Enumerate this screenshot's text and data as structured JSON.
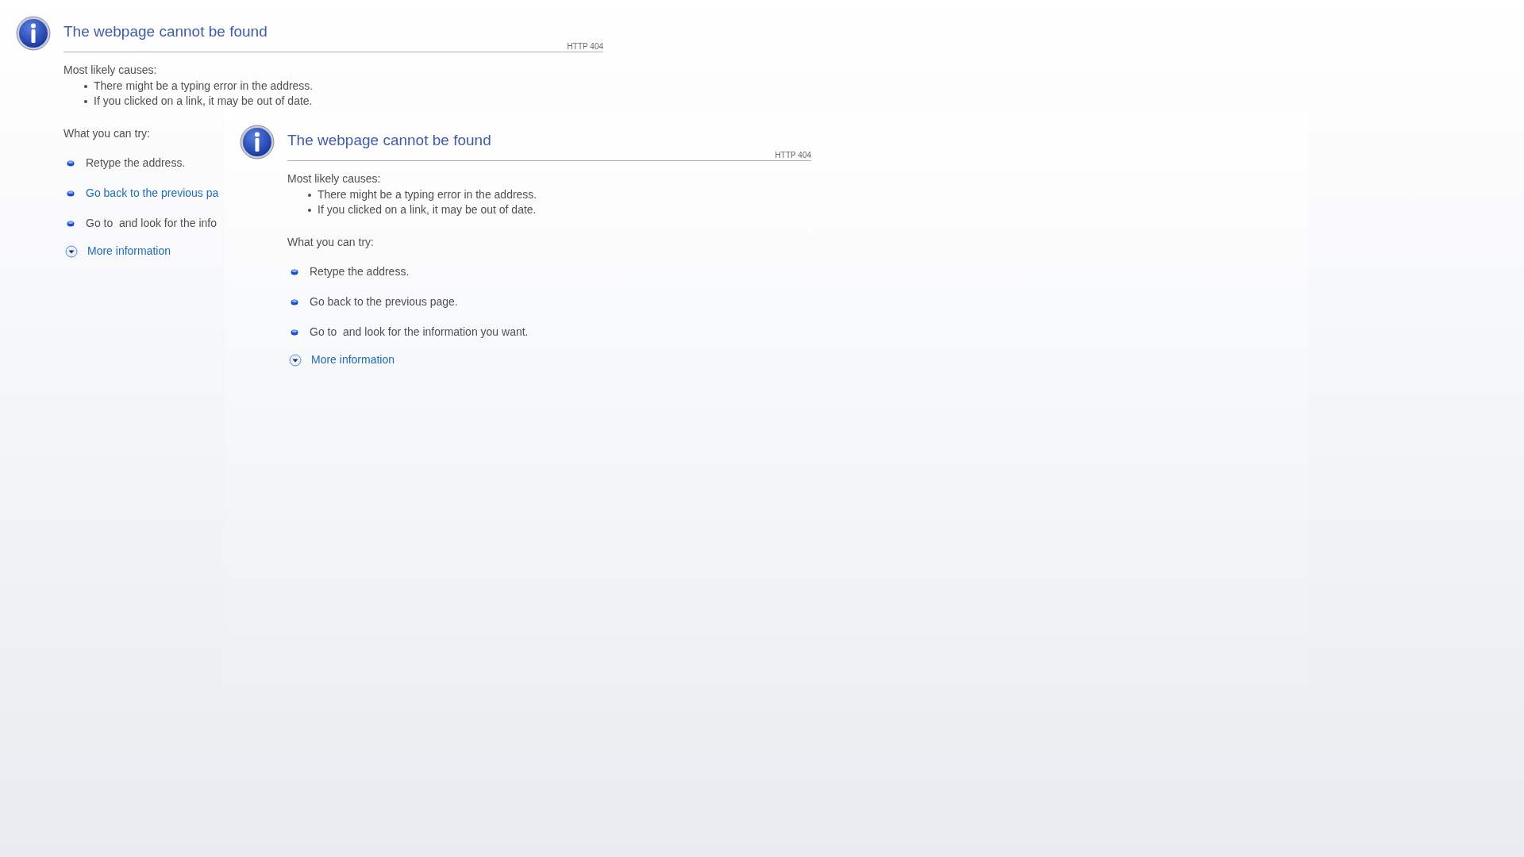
{
  "page": {
    "title": "The webpage cannot be found",
    "code": "HTTP 404",
    "causes_heading": "Most likely causes:",
    "causes": [
      "There might be a typing error in the address.",
      "If you clicked on a link, it may be out of date."
    ],
    "try_heading": "What you can try:",
    "try_items": [
      {
        "kind": "text",
        "text": "Retype the address."
      },
      {
        "kind": "link",
        "text": "Go back to the previous pa"
      },
      {
        "kind": "text",
        "text": "Go to  and look for the info"
      }
    ],
    "more_information": "More information"
  },
  "embedded_frame": {
    "title": "The webpage cannot be found",
    "code": "HTTP 404",
    "causes_heading": "Most likely causes:",
    "causes": [
      "There might be a typing error in the address.",
      "If you clicked on a link, it may be out of date."
    ],
    "try_heading": "What you can try:",
    "try_items": [
      {
        "kind": "text",
        "text": "Retype the address."
      },
      {
        "kind": "text",
        "text": "Go back to the previous page."
      },
      {
        "kind": "text",
        "text": "Go to  and look for the information you want."
      }
    ],
    "more_information": "More information"
  }
}
